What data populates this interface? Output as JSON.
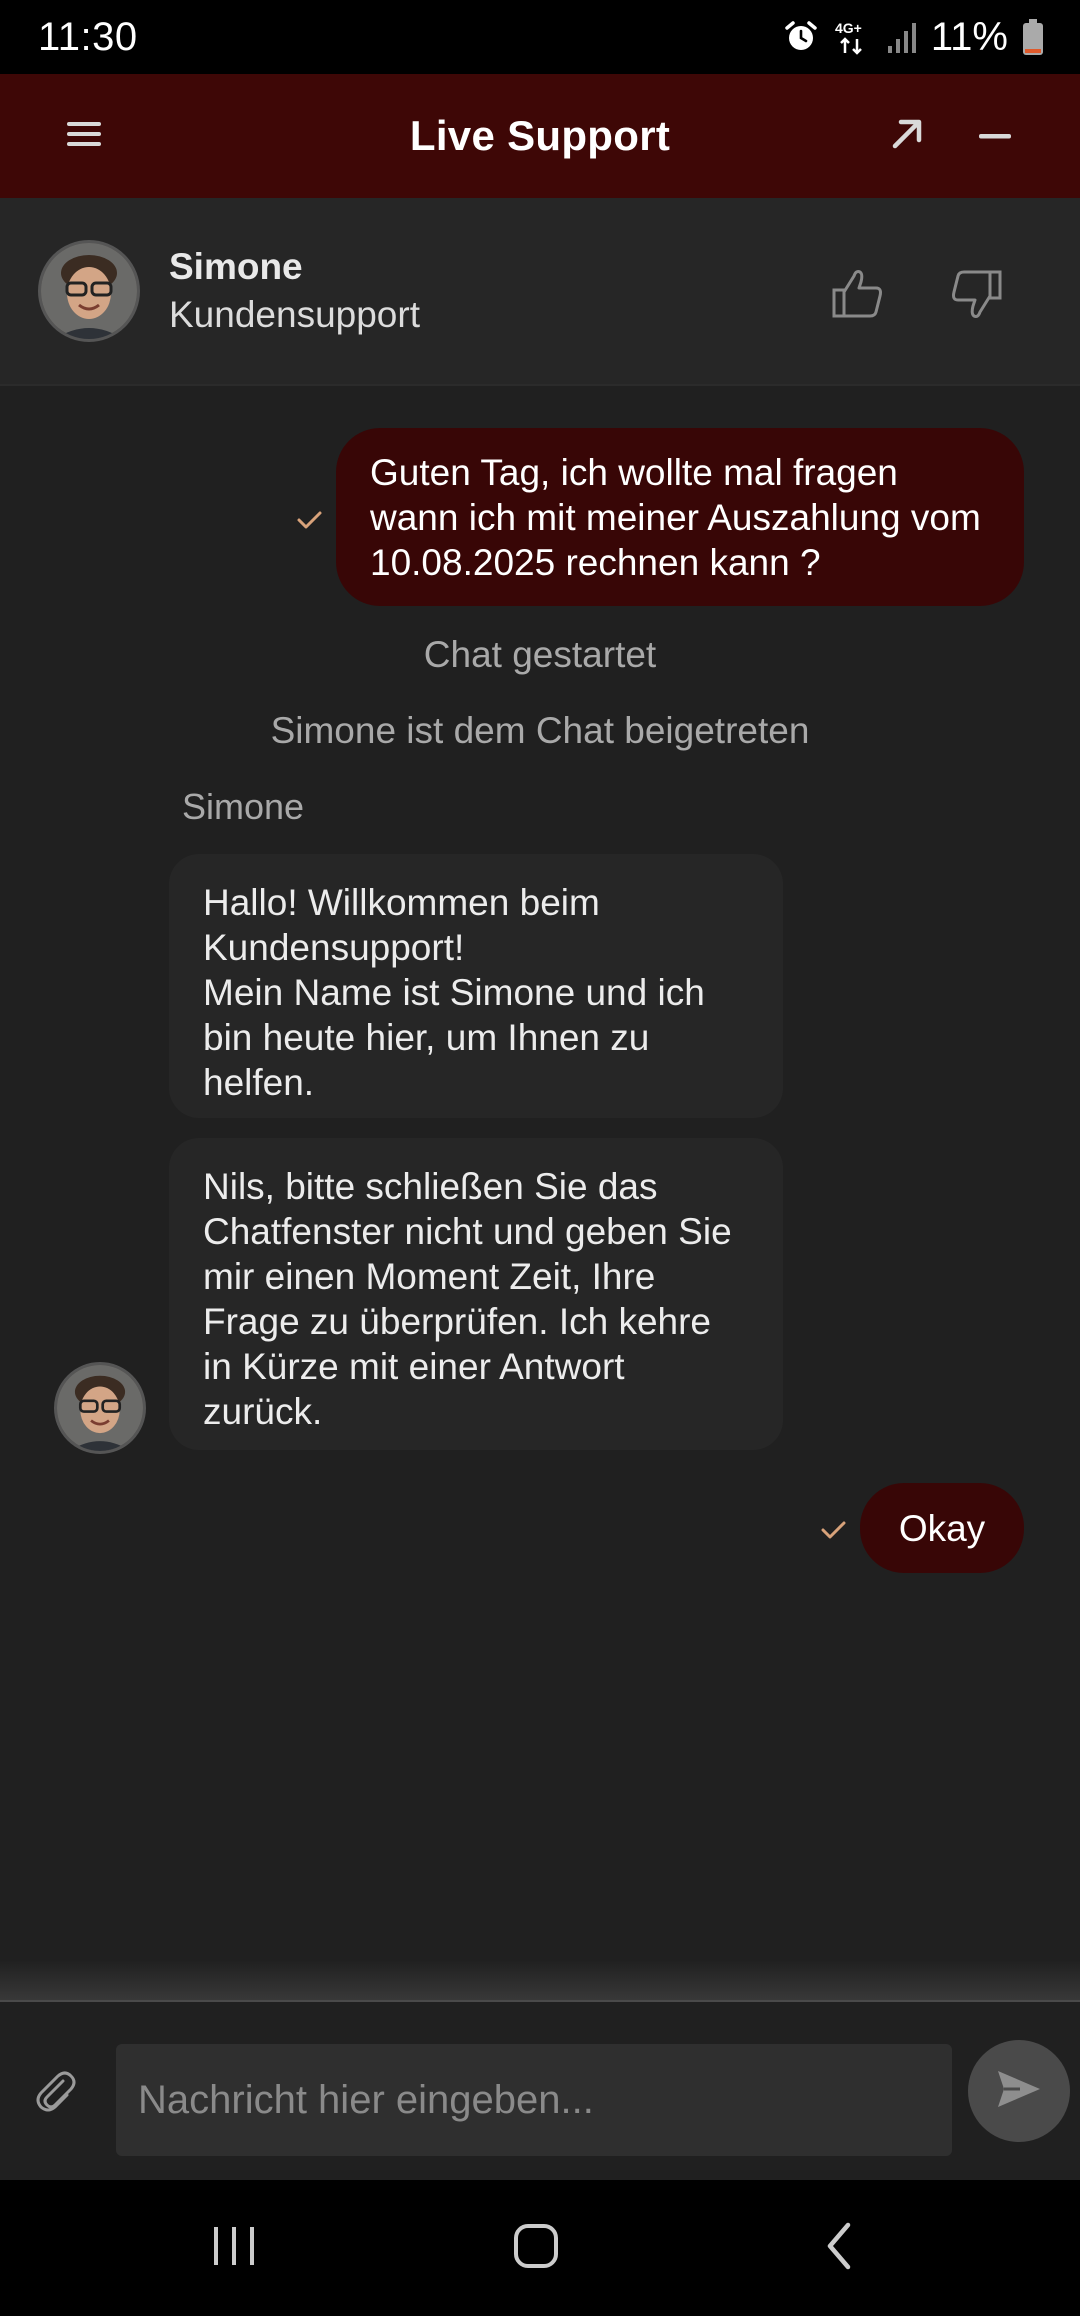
{
  "status_bar": {
    "time": "11:30",
    "network": "4G+",
    "battery": "11%",
    "icons": [
      "alarm-icon",
      "network-4g-icon",
      "signal-icon",
      "battery-low-icon"
    ]
  },
  "header": {
    "title": "Live Support",
    "icons": [
      "menu-icon",
      "expand-icon",
      "minimize-icon"
    ]
  },
  "agent": {
    "name": "Simone",
    "role": "Kundensupport",
    "rating_icons": [
      "thumbs-up-icon",
      "thumbs-down-icon"
    ]
  },
  "messages": {
    "user_1": "Guten Tag, ich wollte mal fragen wann ich mit meiner Auszahlung vom 10.08.2025 rechnen kann ?",
    "system_started": "Chat gestartet",
    "system_joined": "Simone ist dem Chat beigetreten",
    "sender_label": "Simone",
    "agent_1_line1": "Hallo! Willkommen beim Kundensupport!",
    "agent_1_line2": "Mein Name ist Simone und ich bin heute hier, um Ihnen zu helfen.",
    "agent_2": "Nils, bitte schließen Sie das Chatfenster nicht und geben Sie mir einen Moment Zeit, Ihre Frage zu überprüfen. Ich kehre in Kürze mit einer Antwort zurück.",
    "user_2": "Okay"
  },
  "composer": {
    "placeholder": "Nachricht hier eingeben...",
    "value": ""
  },
  "colors": {
    "header_bg": "#3e0706",
    "user_bubble": "#380606",
    "agent_bubble": "#262626",
    "background": "#202020",
    "check": "#d8a27a"
  }
}
